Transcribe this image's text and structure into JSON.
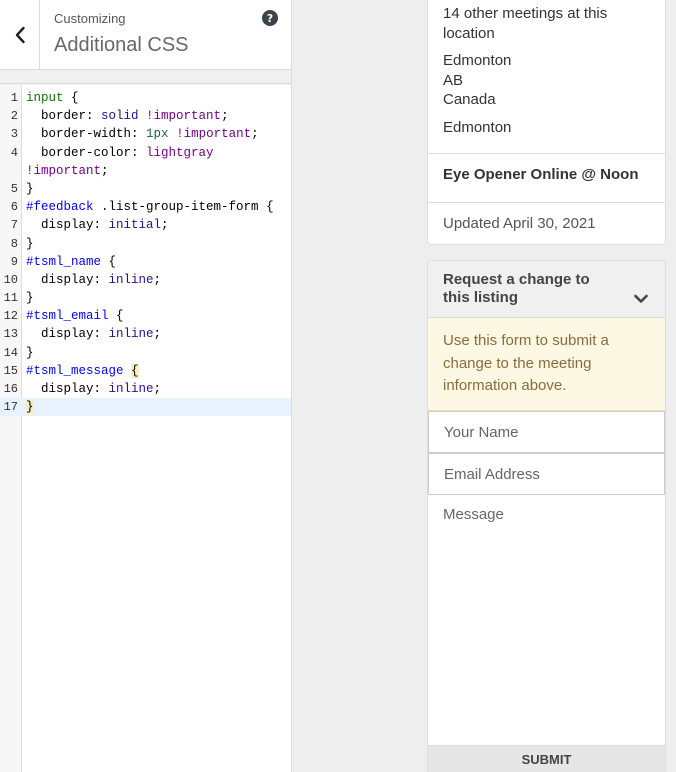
{
  "customizer": {
    "kicker": "Customizing",
    "title": "Additional CSS",
    "help_glyph": "?"
  },
  "editor": {
    "line_numbers": [
      "1",
      "2",
      "3",
      "4",
      "5",
      "6",
      "7",
      "8",
      "9",
      "10",
      "11",
      "12",
      "13",
      "14",
      "15",
      "16",
      "17"
    ],
    "lines": [
      "input {",
      "  border: solid !important;",
      "  border-width: 1px !important;",
      "  border-color: lightgray",
      "!important;",
      "}",
      "#feedback .list-group-item-form {",
      "  display: initial;",
      "}",
      "#tsml_name {",
      "  display: inline;",
      "}",
      "#tsml_email {",
      "  display: inline;",
      "}",
      "#tsml_message {",
      "  display: inline;",
      "}"
    ]
  },
  "location": {
    "other_meetings": "14 other meetings at this location",
    "city": "Edmonton",
    "province": "AB",
    "country": "Canada",
    "region": "Edmonton"
  },
  "meeting": {
    "name": "Eye Opener Online @ Noon",
    "updated": "Updated April 30, 2021"
  },
  "feedback": {
    "heading": "Request a change to this listing",
    "notice": "Use this form to submit a change to the meeting information above.",
    "name_placeholder": "Your Name",
    "email_placeholder": "Email Address",
    "message_placeholder": "Message",
    "submit_label": "SUBMIT"
  },
  "icons": {
    "back": "chevron-left-icon",
    "help": "question-circle-icon",
    "toggle": "chevron-down-icon"
  }
}
